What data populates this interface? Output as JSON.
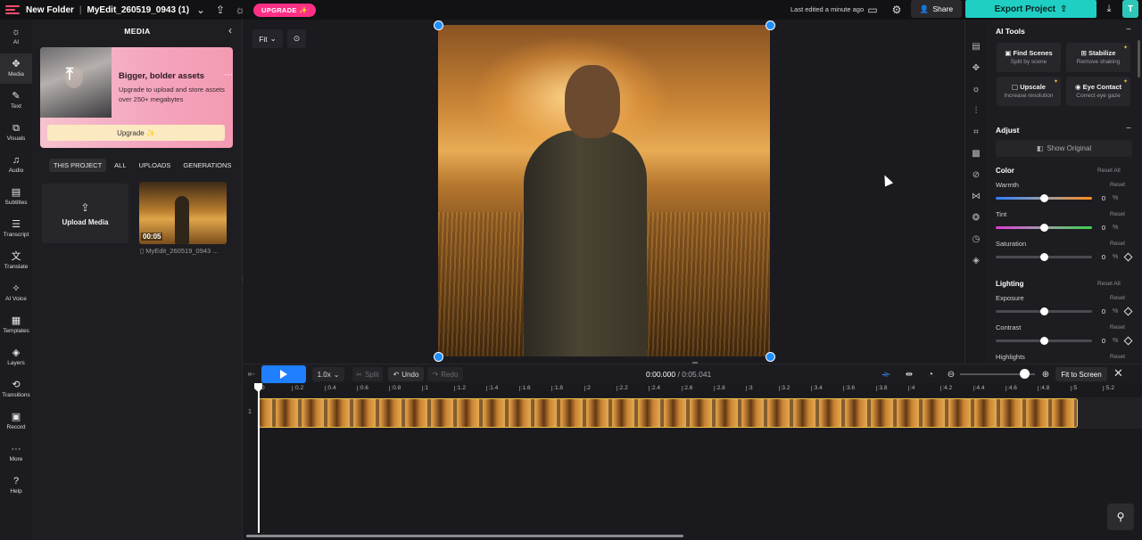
{
  "topbar": {
    "folder": "New Folder",
    "project_name": "MyEdit_260519_0943 (1)",
    "upgrade_label": "UPGRADE ✨",
    "last_edited": "Last edited a minute ago",
    "share_label": "Share",
    "export_label": "Export Project",
    "avatar_initial": "T"
  },
  "rail": [
    {
      "id": "ai",
      "label": "AI",
      "icon": "☼"
    },
    {
      "id": "media",
      "label": "Media",
      "icon": "✥"
    },
    {
      "id": "text",
      "label": "Text",
      "icon": "✎"
    },
    {
      "id": "visuals",
      "label": "Visuals",
      "icon": "⧉"
    },
    {
      "id": "audio",
      "label": "Audio",
      "icon": "♫"
    },
    {
      "id": "subtitles",
      "label": "Subtitles",
      "icon": "▤"
    },
    {
      "id": "transcript",
      "label": "Transcript",
      "icon": "☰"
    },
    {
      "id": "translate",
      "label": "Translate",
      "icon": "文"
    },
    {
      "id": "ai-voice",
      "label": "AI Voice",
      "icon": "✧"
    },
    {
      "id": "templates",
      "label": "Templates",
      "icon": "▦"
    },
    {
      "id": "layers",
      "label": "Layers",
      "icon": "◈"
    },
    {
      "id": "transitions",
      "label": "Transitions",
      "icon": "⟲"
    },
    {
      "id": "record",
      "label": "Record",
      "icon": "▣"
    },
    {
      "id": "more",
      "label": "More",
      "icon": "···"
    },
    {
      "id": "help",
      "label": "Help",
      "icon": "?"
    }
  ],
  "media": {
    "title": "MEDIA",
    "promo": {
      "title": "Bigger, bolder assets",
      "description": "Upgrade to upload and store assets over 250+ megabytes",
      "button": "Upgrade ✨"
    },
    "tabs": [
      "THIS PROJECT",
      "ALL",
      "UPLOADS",
      "GENERATIONS"
    ],
    "active_tab": "THIS PROJECT",
    "upload_label": "Upload Media",
    "asset": {
      "duration": "00:05",
      "name": "MyEdit_260519_0943 ..."
    }
  },
  "canvas": {
    "fit_label": "Fit"
  },
  "tool_strip": [
    "film-icon",
    "move-icon",
    "ai-tools-icon",
    "adjust-icon",
    "crop-icon",
    "filter-icon",
    "mask-icon",
    "transition-icon",
    "color-icon",
    "speed-icon",
    "layers-icon"
  ],
  "props": {
    "ai_tools_title": "AI Tools",
    "ai_tools": [
      {
        "title": "Find Scenes",
        "subtitle": "Split by scene"
      },
      {
        "title": "Stabilize",
        "subtitle": "Remove shaking"
      },
      {
        "title": "Upscale",
        "subtitle": "Increase resolution"
      },
      {
        "title": "Eye Contact",
        "subtitle": "Correct eye gaze"
      }
    ],
    "adjust_title": "Adjust",
    "show_original": "Show Original",
    "color_title": "Color",
    "lighting_title": "Lighting",
    "reset_all": "Reset All",
    "reset": "Reset",
    "percent": "%",
    "sliders": [
      {
        "label": "Warmth",
        "value": "0"
      },
      {
        "label": "Tint",
        "value": "0"
      },
      {
        "label": "Saturation",
        "value": "0"
      },
      {
        "label": "Exposure",
        "value": "0"
      },
      {
        "label": "Contrast",
        "value": "0"
      },
      {
        "label": "Highlights",
        "value": ""
      }
    ]
  },
  "timeline": {
    "speed": "1.0x",
    "split": "Split",
    "undo": "Undo",
    "redo": "Redo",
    "current_time": "0:00.000",
    "total_time": "/ 0:05.041",
    "fit_to_screen": "Fit to Screen",
    "track_number": "1",
    "ticks": [
      "0",
      ":0.2",
      ":0.4",
      ":0.6",
      ":0.8",
      ":1",
      ":1.2",
      ":1.4",
      ":1.6",
      ":1.8",
      ":2",
      ":2.2",
      ":2.4",
      ":2.6",
      ":2.8",
      ":3",
      ":3.2",
      ":3.4",
      ":3.6",
      ":3.8",
      ":4",
      ":4.2",
      ":4.4",
      ":4.6",
      ":4.8",
      ":5",
      ":5.2"
    ]
  }
}
